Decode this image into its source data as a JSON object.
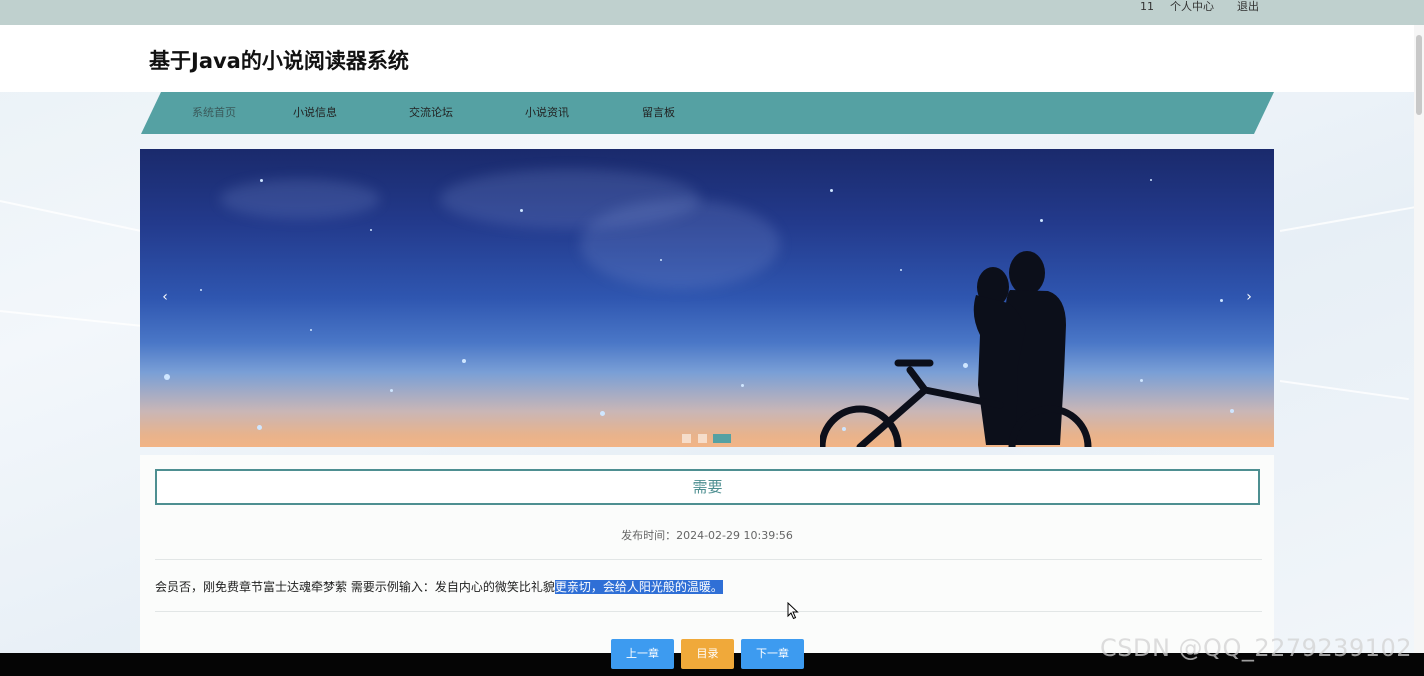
{
  "topbar": {
    "username": "11",
    "profile": "个人中心",
    "logout": "退出"
  },
  "header": {
    "title": "基于Java的小说阅读器系统"
  },
  "nav": {
    "items": [
      {
        "label": "系统首页"
      },
      {
        "label": "小说信息"
      },
      {
        "label": "交流论坛"
      },
      {
        "label": "小说资讯"
      },
      {
        "label": "留言板"
      }
    ]
  },
  "banner": {
    "prev": "‹",
    "next": "›",
    "active_slide": 3,
    "slide_count": 3
  },
  "article": {
    "title": "需要",
    "publish_time": "发布时间：2024-02-29 10:39:56",
    "body_plain": "会员否，刚免费章节富士达魂牵梦萦 需要示例输入：发自内心的微笑比礼貌",
    "body_selected": "更亲切，会给人阳光般的温暖。"
  },
  "buttons": {
    "prev_chapter": "上一章",
    "catalog": "目录",
    "next_chapter": "下一章"
  },
  "colors": {
    "accent": "#55a1a3",
    "title_border": "#4e8f91",
    "btn_blue": "#3d9bf0",
    "btn_orange": "#f0a93a",
    "selection": "#2f6fd6"
  },
  "watermark": "CSDN @QQ_2279239102"
}
